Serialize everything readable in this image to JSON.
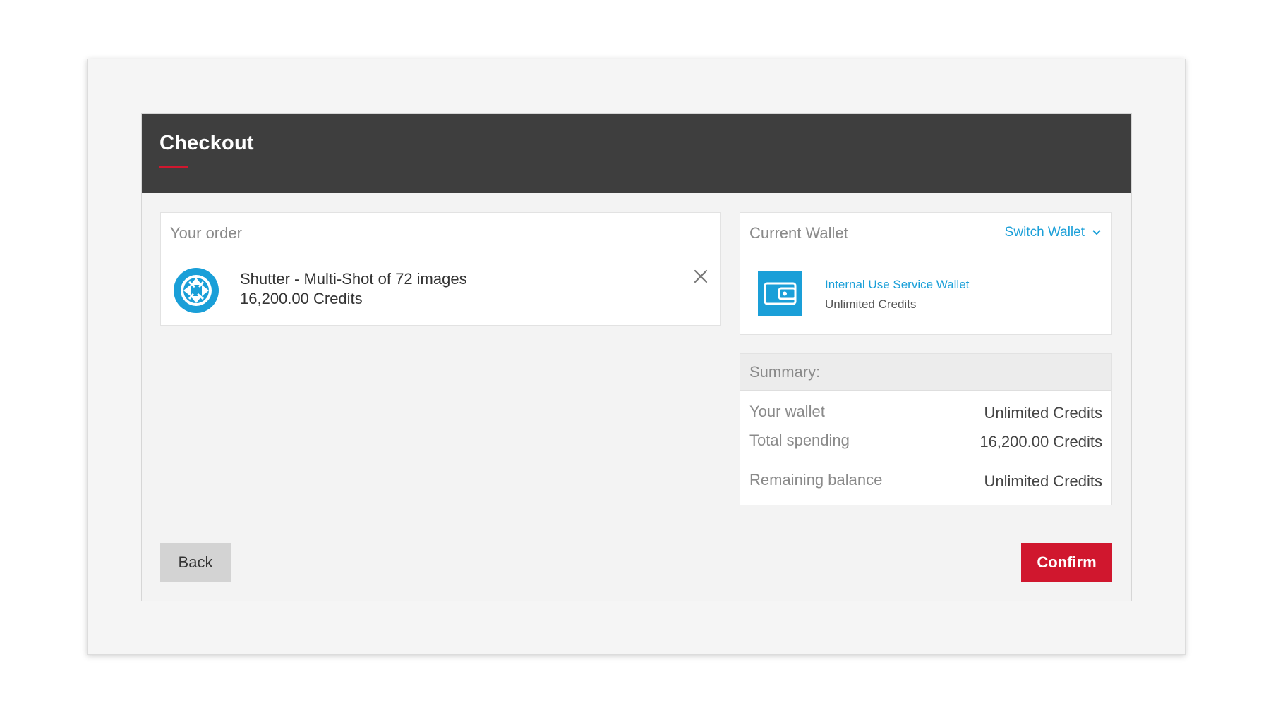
{
  "modal": {
    "title": "Checkout"
  },
  "order": {
    "header": "Your order",
    "items": [
      {
        "icon": "shutter-aperture-icon",
        "name": "Shutter - Multi-Shot of 72 images",
        "price": "16,200.00 Credits"
      }
    ]
  },
  "wallet": {
    "header": "Current Wallet",
    "switch_label": "Switch Wallet",
    "icon": "wallet-icon",
    "name": "Internal Use Service Wallet",
    "credits": "Unlimited Credits"
  },
  "summary": {
    "header": "Summary:",
    "rows": [
      {
        "label": "Your wallet",
        "value": "Unlimited Credits"
      },
      {
        "label": "Total spending",
        "value": "16,200.00 Credits"
      },
      {
        "label": "Remaining balance",
        "value": "Unlimited Credits"
      }
    ]
  },
  "footer": {
    "back_label": "Back",
    "confirm_label": "Confirm"
  },
  "colors": {
    "accent": "#1a9fd8",
    "brand_red": "#d0172e",
    "header_bg": "#3e3e3e"
  }
}
